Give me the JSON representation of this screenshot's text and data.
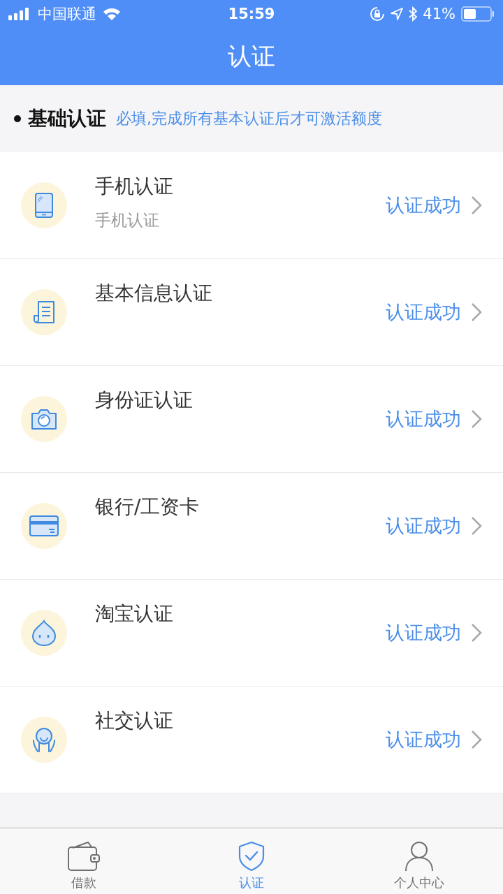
{
  "status_bar": {
    "carrier": "中国联通",
    "time": "15:59",
    "battery": "41%"
  },
  "header": {
    "title": "认证"
  },
  "section": {
    "title": "基础认证",
    "note": "必填,完成所有基本认证后才可激活额度"
  },
  "items": [
    {
      "kind": "phone",
      "title": "手机认证",
      "subtitle": "手机认证",
      "status": "认证成功"
    },
    {
      "kind": "form",
      "title": "基本信息认证",
      "status": "认证成功"
    },
    {
      "kind": "camera",
      "title": "身份证认证",
      "status": "认证成功"
    },
    {
      "kind": "card",
      "title": "银行/工资卡",
      "status": "认证成功"
    },
    {
      "kind": "taobao",
      "title": "淘宝认证",
      "status": "认证成功"
    },
    {
      "kind": "social",
      "title": "社交认证",
      "status": "认证成功"
    }
  ],
  "tabs": [
    {
      "kind": "wallet",
      "label": "借款",
      "selected": false
    },
    {
      "kind": "shield",
      "label": "认证",
      "selected": true
    },
    {
      "kind": "person",
      "label": "个人中心",
      "selected": false
    }
  ]
}
